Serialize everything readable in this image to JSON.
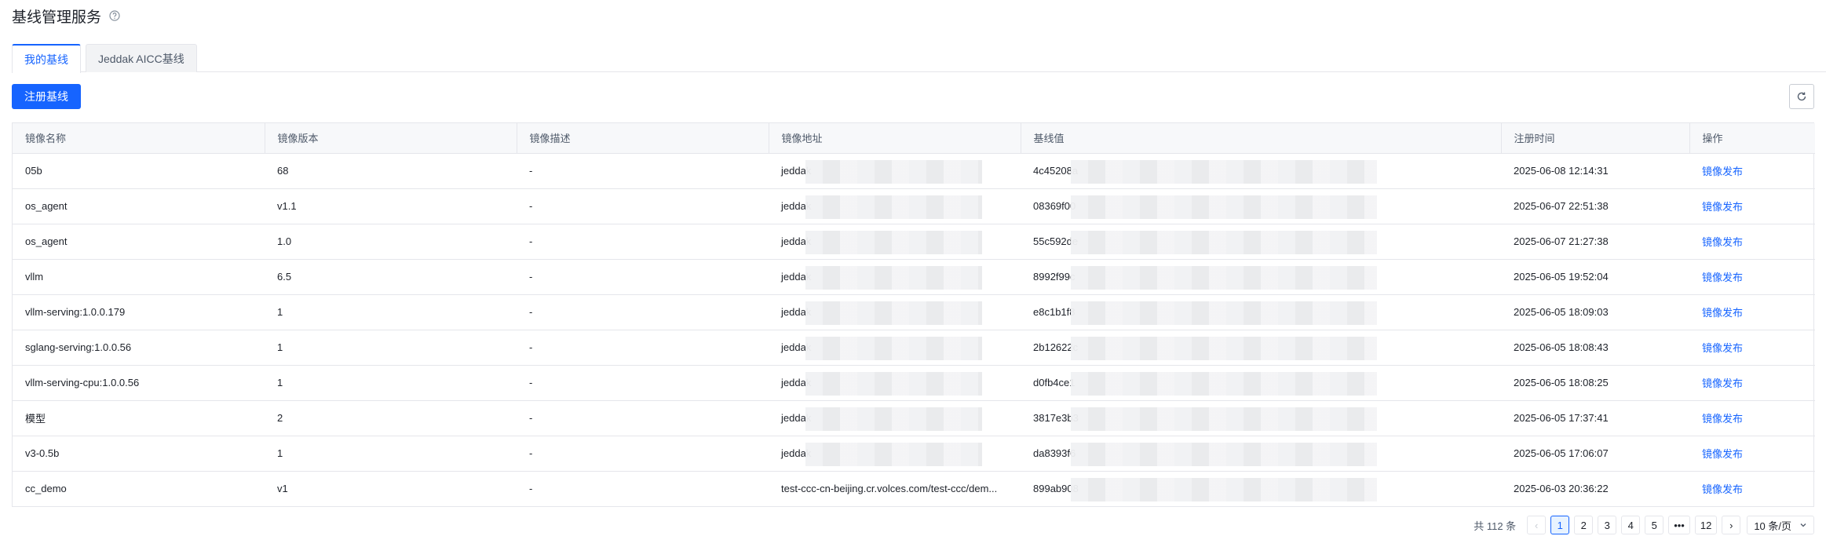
{
  "header": {
    "title": "基线管理服务"
  },
  "tabs": [
    {
      "label": "我的基线"
    },
    {
      "label": "Jeddak AICC基线"
    }
  ],
  "toolbar": {
    "register_label": "注册基线"
  },
  "table": {
    "columns": [
      "镜像名称",
      "镜像版本",
      "镜像描述",
      "镜像地址",
      "基线值",
      "注册时间",
      "操作"
    ],
    "rows": [
      {
        "name": "05b",
        "version": "68",
        "desc": "-",
        "addr": "jeddak",
        "base": "4c45208a",
        "time": "2025-06-08 12:14:31",
        "op": "镜像发布"
      },
      {
        "name": "os_agent",
        "version": "v1.1",
        "desc": "-",
        "addr": "jeddak",
        "base": "08369f00",
        "time": "2025-06-07 22:51:38",
        "op": "镜像发布"
      },
      {
        "name": "os_agent",
        "version": "1.0",
        "desc": "-",
        "addr": "jeddak",
        "base": "55c592de",
        "time": "2025-06-07 21:27:38",
        "op": "镜像发布"
      },
      {
        "name": "vllm",
        "version": "6.5",
        "desc": "-",
        "addr": "jeddak",
        "base": "8992f99c",
        "time": "2025-06-05 19:52:04",
        "op": "镜像发布"
      },
      {
        "name": "vllm-serving:1.0.0.179",
        "version": "1",
        "desc": "-",
        "addr": "jeddak",
        "base": "e8c1b1f8",
        "time": "2025-06-05 18:09:03",
        "op": "镜像发布"
      },
      {
        "name": "sglang-serving:1.0.0.56",
        "version": "1",
        "desc": "-",
        "addr": "jeddak",
        "base": "2b12622c",
        "time": "2025-06-05 18:08:43",
        "op": "镜像发布"
      },
      {
        "name": "vllm-serving-cpu:1.0.0.56",
        "version": "1",
        "desc": "-",
        "addr": "jeddak",
        "base": "d0fb4ce1",
        "time": "2025-06-05 18:08:25",
        "op": "镜像发布"
      },
      {
        "name": "模型",
        "version": "2",
        "desc": "-",
        "addr": "jeddak",
        "base": "3817e3b3",
        "time": "2025-06-05 17:37:41",
        "op": "镜像发布"
      },
      {
        "name": "v3-0.5b",
        "version": "1",
        "desc": "-",
        "addr": "jeddak",
        "base": "da8393f6",
        "time": "2025-06-05 17:06:07",
        "op": "镜像发布"
      },
      {
        "name": "cc_demo",
        "version": "v1",
        "desc": "-",
        "addr": "test-ccc-cn-beijing.cr.volces.com/test-ccc/dem...",
        "base": "899ab908",
        "time": "2025-06-03 20:36:22",
        "op": "镜像发布"
      }
    ]
  },
  "pagination": {
    "total": "共 112 条",
    "prev": "‹",
    "pages": [
      "1",
      "2",
      "3",
      "4",
      "5",
      "•••",
      "12"
    ],
    "next": "›",
    "page_size": "10 条/页"
  },
  "colors": {
    "accent": "#1664ff",
    "border": "#e5e6eb",
    "header_bg": "#f7f8fa"
  },
  "icons": {
    "help": "question-circle-icon",
    "refresh": "refresh-icon",
    "chevron": "chevron-down-icon"
  }
}
